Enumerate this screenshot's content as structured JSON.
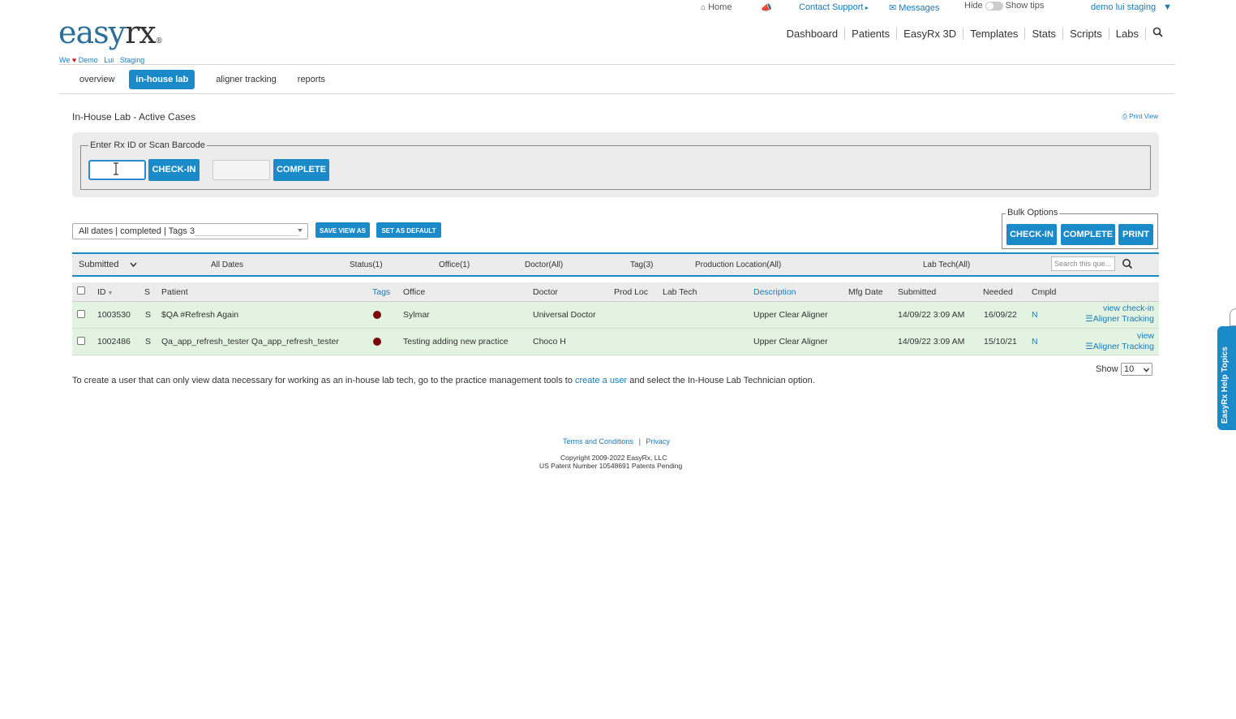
{
  "topbar": {
    "home": "Home",
    "contact_support": "Contact Support",
    "messages": "Messages",
    "hide": "Hide",
    "show_tips": "Show tips",
    "user": "demo lui staging"
  },
  "logo": {
    "easy": "easy",
    "rx": "rx",
    "reg": "®"
  },
  "tagline": {
    "we": "We",
    "heart": "♥",
    "text": "Demo   Lui   Staging"
  },
  "mainnav": [
    "Dashboard",
    "Patients",
    "EasyRx 3D",
    "Templates",
    "Stats",
    "Scripts",
    "Labs"
  ],
  "subnav": [
    "overview",
    "in-house lab",
    "aligner tracking",
    "reports"
  ],
  "page": {
    "title": "In-House Lab - Active Cases",
    "print_view": "Print View"
  },
  "scan": {
    "legend": "Enter Rx ID or Scan Barcode",
    "checkin_label": "CHECK-IN",
    "complete_label": "COMPLETE"
  },
  "view": {
    "selected": "All dates | completed | Tags 3",
    "save_view_as": "SAVE VIEW AS",
    "set_as_default": "SET AS DEFAULT"
  },
  "bulk": {
    "legend": "Bulk Options",
    "checkin": "CHECK-IN",
    "complete": "COMPLETE",
    "print": "PRINT"
  },
  "filters": {
    "submitted": "Submitted",
    "dates": "All Dates",
    "status": "Status(1)",
    "office": "Office(1)",
    "doctor": "Doctor(All)",
    "tag": "Tag(3)",
    "production_location": "Production Location(All)",
    "lab_tech": "Lab Tech(All)",
    "search_placeholder": "Search this que..."
  },
  "table": {
    "headers": {
      "id": "ID",
      "s": "S",
      "patient": "Patient",
      "tags": "Tags",
      "office": "Office",
      "doctor": "Doctor",
      "prod_loc": "Prod Loc",
      "lab_tech": "Lab Tech",
      "description": "Description",
      "mfg_date": "Mfg Date",
      "submitted": "Submitted",
      "needed": "Needed",
      "cmpld": "Cmpld"
    },
    "rows": [
      {
        "id": "1003530",
        "s": "S",
        "patient": "$QA #Refresh Again",
        "tag_color": "#7a0b0b",
        "office": "Sylmar",
        "doctor": "Universal Doctor",
        "description": "Upper Clear Aligner",
        "submitted": "14/09/22 3:09 AM",
        "needed": "16/09/22",
        "cmpld": "N",
        "action1": "view check-in",
        "action2": "Aligner Tracking"
      },
      {
        "id": "1002486",
        "s": "S",
        "patient": "Qa_app_refresh_tester Qa_app_refresh_tester",
        "tag_color": "#7a0b0b",
        "office": "Testing adding new practice",
        "doctor": "Choco H",
        "description": "Upper Clear Aligner",
        "submitted": "14/09/22 3:09 AM",
        "needed": "15/10/21",
        "cmpld": "N",
        "action1": "view",
        "action2": "Aligner Tracking"
      }
    ]
  },
  "pager": {
    "show": "Show",
    "value": "10"
  },
  "note": {
    "before": "To create a user that can only view data necessary for working as an in-house lab tech, go to the practice management tools to ",
    "link": "create a user",
    "after": " and select the In-House Lab Technician option."
  },
  "footer": {
    "terms": "Terms and Conditions",
    "sep": "|",
    "privacy": "Privacy",
    "copyright": "Copyright 2009-2022 EasyRx, LLC",
    "patent": "US Patent Number 10548691 Patents Pending"
  },
  "help_tab": "EasyRx Help Topics",
  "colors": {
    "accent": "#1a8ac9",
    "row_bg": "#e3f3e1",
    "heart": "#cc1f1f",
    "tag": "#7a0b0b"
  }
}
